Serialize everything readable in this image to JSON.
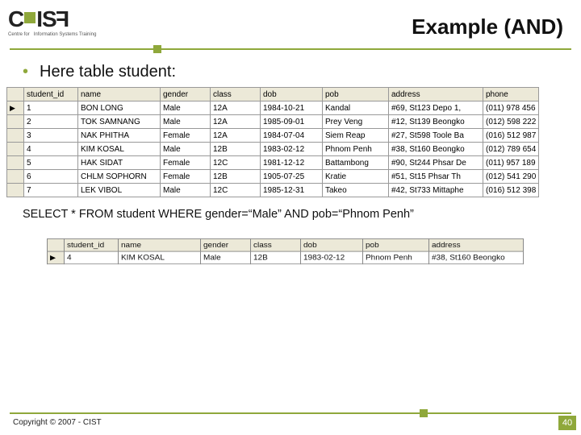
{
  "logo": {
    "main": "CIST",
    "sub1": "Centre for",
    "sub2": "Information Systems Training"
  },
  "title": "Example (AND)",
  "bullet": "Here table student:",
  "table1": {
    "headers": [
      "student_id",
      "name",
      "gender",
      "class",
      "dob",
      "pob",
      "address",
      "phone"
    ],
    "rows": [
      [
        "1",
        "BON LONG",
        "Male",
        "12A",
        "1984-10-21",
        "Kandal",
        "#69, St123 Depo 1,",
        "(011) 978 456"
      ],
      [
        "2",
        "TOK SAMNANG",
        "Male",
        "12A",
        "1985-09-01",
        "Prey Veng",
        "#12, St139 Beongko",
        "(012) 598 222"
      ],
      [
        "3",
        "NAK PHITHA",
        "Female",
        "12A",
        "1984-07-04",
        "Siem Reap",
        "#27, St598 Toole Ba",
        "(016) 512 987"
      ],
      [
        "4",
        "KIM KOSAL",
        "Male",
        "12B",
        "1983-02-12",
        "Phnom Penh",
        "#38, St160 Beongko",
        "(012) 789 654"
      ],
      [
        "5",
        "HAK SIDAT",
        "Female",
        "12C",
        "1981-12-12",
        "Battambong",
        "#90, St244 Phsar De",
        "(011) 957 189"
      ],
      [
        "6",
        "CHLM SOPHORN",
        "Female",
        "12B",
        "1905-07-25",
        "Kratie",
        "#51, St15 Phsar Th",
        "(012) 541 290"
      ],
      [
        "7",
        "LEK VIBOL",
        "Male",
        "12C",
        "1985-12-31",
        "Takeo",
        "#42, St733 Mittaphe",
        "(016) 512 398"
      ]
    ]
  },
  "query": "SELECT * FROM student WHERE gender=“Male” AND pob=“Phnom Penh”",
  "table2": {
    "headers": [
      "student_id",
      "name",
      "gender",
      "class",
      "dob",
      "pob",
      "address"
    ],
    "rows": [
      [
        "4",
        "KIM KOSAL",
        "Male",
        "12B",
        "1983-02-12",
        "Phnom Penh",
        "#38, St160 Beongko"
      ]
    ]
  },
  "footer": "Copyright © 2007 - CIST",
  "page": "40"
}
